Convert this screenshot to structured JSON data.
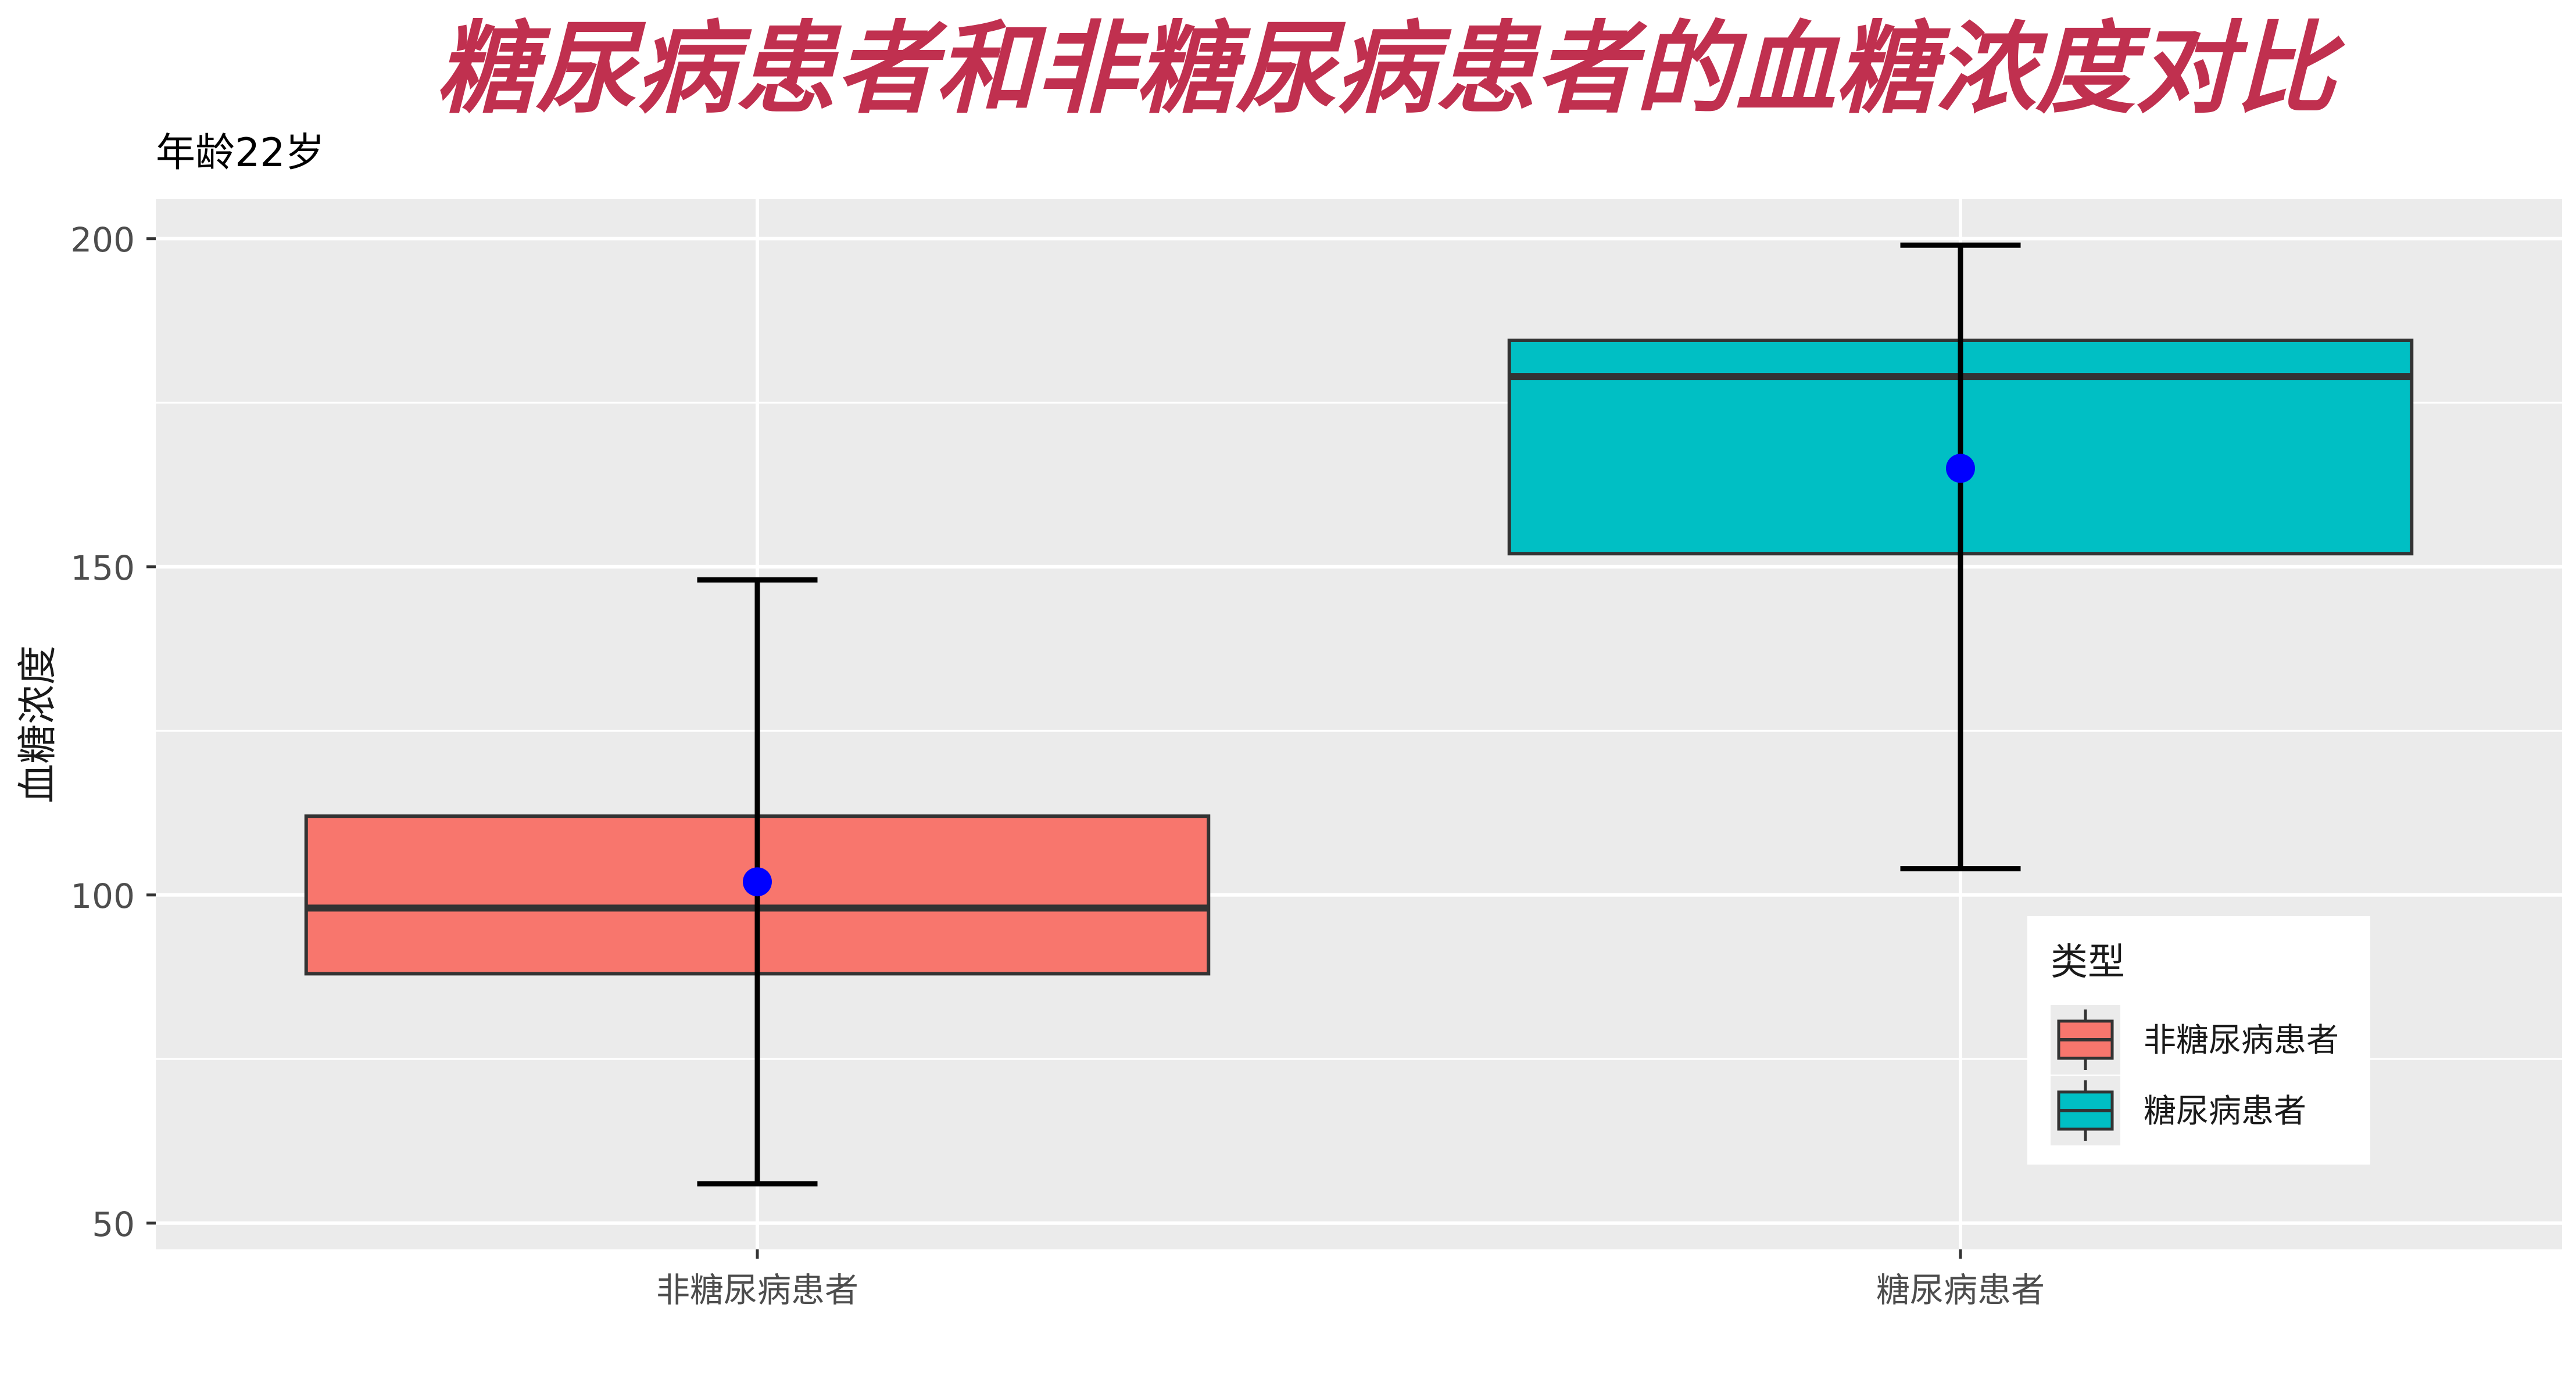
{
  "chart_data": {
    "type": "boxplot",
    "title": "糖尿病患者和非糖尿病患者的血糖浓度对比",
    "subtitle": "年龄22岁",
    "xlabel": "",
    "ylabel": "血糖浓度",
    "ylim": [
      46,
      206
    ],
    "yticks": [
      50,
      100,
      150,
      200
    ],
    "ytick_labels": [
      "50",
      "100",
      "150",
      "200"
    ],
    "categories": [
      "非糖尿病患者",
      "糖尿病患者"
    ],
    "grid": true,
    "legend_position": "bottom-right, inside plot",
    "legend_title": "类型",
    "series": [
      {
        "name": "非糖尿病患者",
        "color": "#F8766D",
        "whisker_low": 56,
        "q1": 88,
        "median": 98,
        "q3": 112,
        "whisker_high": 148,
        "mean": 102
      },
      {
        "name": "糖尿病患者",
        "color": "#00BFC4",
        "whisker_low": 104,
        "q1": 152,
        "median": 179,
        "q3": 184.5,
        "whisker_high": 199,
        "mean": 165
      }
    ],
    "mean_marker_color": "#0000FF",
    "panel_background": "#EBEBEB",
    "grid_color": "#FFFFFF"
  }
}
